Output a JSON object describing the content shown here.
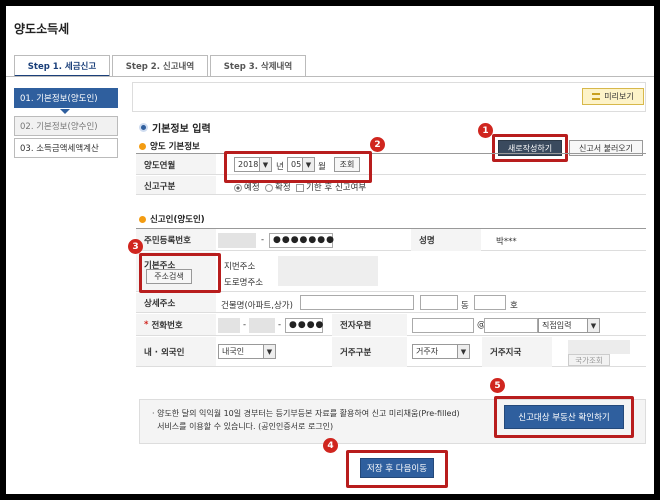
{
  "page_title": "양도소득세",
  "tabs": [
    {
      "label": "Step 1. 세금신고"
    },
    {
      "label": "Step 2. 신고내역"
    },
    {
      "label": "Step 3. 삭제내역"
    }
  ],
  "sidebar": {
    "items": [
      {
        "label": "01. 기본정보(양도인)"
      },
      {
        "label": "02. 기본정보(양수인)"
      },
      {
        "label": "03. 소득금액세액계산"
      }
    ]
  },
  "preview_button": "미리보기",
  "section_basic": "기본정보 입력",
  "sub_transfer_basic": "양도 기본정보",
  "new_write_button": "새로작성하기",
  "load_return_button": "신고서 불러오기",
  "transfer_year_month": {
    "label": "양도연월",
    "year": "2018",
    "year_unit": "년",
    "month": "05",
    "month_unit": "월",
    "search_button": "조회"
  },
  "filing_type": {
    "label": "신고구분",
    "options": [
      "예정",
      "확정"
    ],
    "late_filing": "기한 후 신고여부"
  },
  "sub_filer": "신고인(양도인)",
  "resident_number": {
    "label": "주민등록번호",
    "dash": "-",
    "masked": "●●●●●●●"
  },
  "name": {
    "label": "성명",
    "value": "박***"
  },
  "address": {
    "label": "기본주소",
    "search_button": "주소검색",
    "jibun": "지번주소",
    "road": "도로명주소"
  },
  "detail_address": {
    "label": "상세주소",
    "placeholder": "건물명(아파트,상가)",
    "dong": "동",
    "ho": "호"
  },
  "phone": {
    "label": "전화번호",
    "dash": "-",
    "masked": "●●●●"
  },
  "email": {
    "label": "전자우편",
    "at": "@",
    "domain_select": "직접입력"
  },
  "nationality": {
    "label": "내 · 외국인",
    "value": "내국인"
  },
  "residency": {
    "label": "거주구분",
    "value": "거주자"
  },
  "residence_country": {
    "label": "거주지국",
    "button": "국가조회"
  },
  "notice_text": "· 양도한 달의 익익월 10일 경부터는 등기부등본 자료를 활용하여 신고 미리채움(Pre-filled)\n  서비스를 이용할 수 있습니다. (공인인증서로 로그인)",
  "confirm_property_button": "신고대상 부동산 확인하기",
  "save_next_button": "저장 후 다음이동",
  "annotations": [
    "1",
    "2",
    "3",
    "4",
    "5"
  ],
  "colors": {
    "accent": "#2f5f9e",
    "annotation_red": "#d0261f"
  }
}
